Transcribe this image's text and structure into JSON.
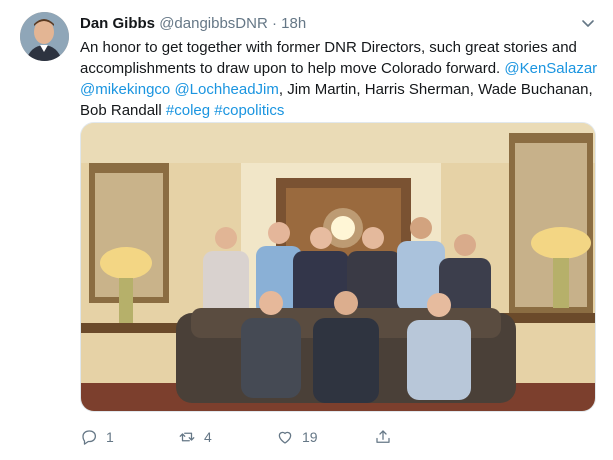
{
  "tweet": {
    "display_name": "Dan Gibbs",
    "handle": "@dangibbsDNR",
    "separator": "·",
    "time": "18h",
    "text_segments": [
      {
        "text": "An honor to get together with former DNR Directors, such great stories and accomplishments to draw upon to help move Colorado forward. ",
        "type": "text"
      },
      {
        "text": "@KenSalazar",
        "type": "mention"
      },
      {
        "text": " ",
        "type": "text"
      },
      {
        "text": "@mikekingco",
        "type": "mention"
      },
      {
        "text": " ",
        "type": "text"
      },
      {
        "text": "@LochheadJim",
        "type": "mention"
      },
      {
        "text": ", Jim Martin, Harris Sherman, Wade Buchanan, Bob Randall ",
        "type": "text"
      },
      {
        "text": "#coleg",
        "type": "hashtag"
      },
      {
        "text": " ",
        "type": "text"
      },
      {
        "text": "#copolitics",
        "type": "hashtag"
      }
    ]
  },
  "actions": {
    "reply_count": "1",
    "retweet_count": "4",
    "like_count": "19"
  },
  "icons": {
    "reply": "reply-icon",
    "retweet": "retweet-icon",
    "like": "heart-icon",
    "share": "share-icon",
    "menu": "chevron-down-icon"
  },
  "colors": {
    "link": "#1b95e0",
    "secondary_text": "#657786"
  }
}
